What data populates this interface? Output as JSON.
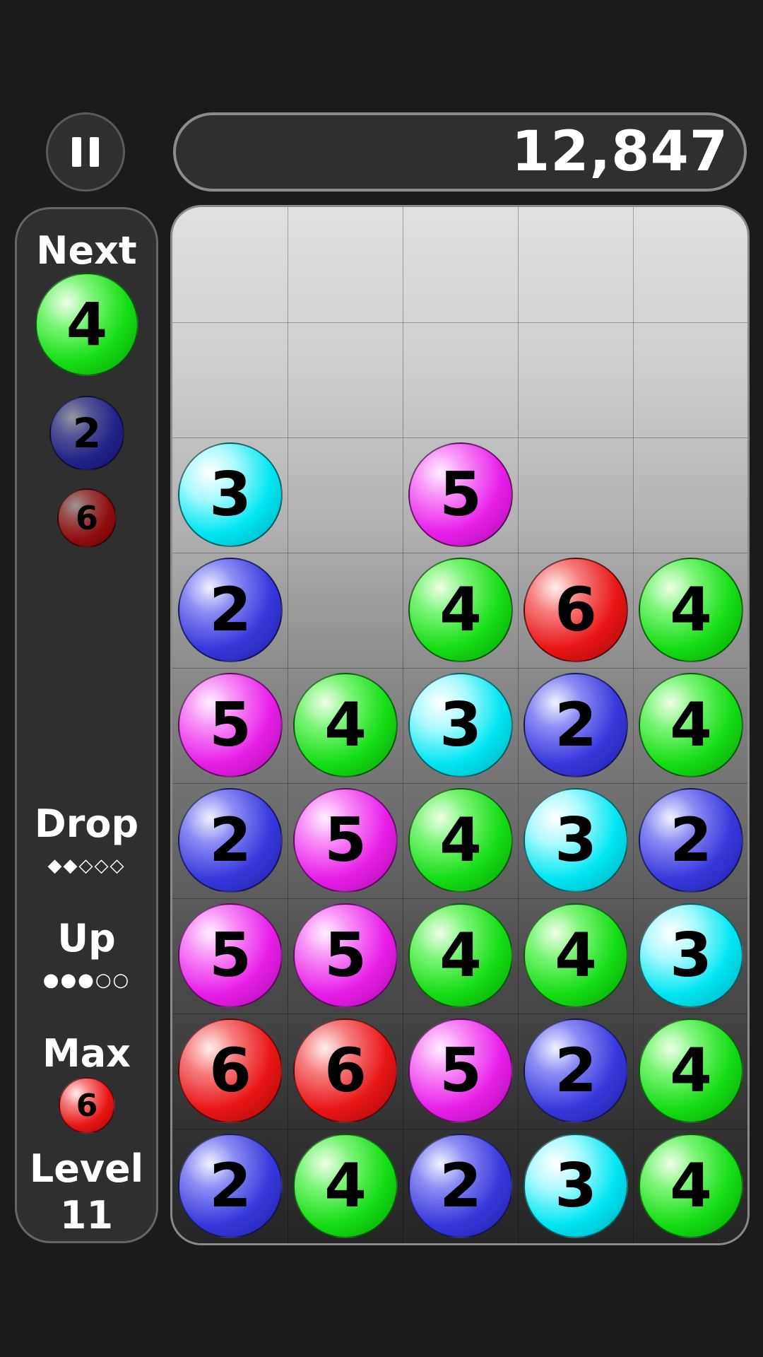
{
  "score": "12,847",
  "side": {
    "next_label": "Next",
    "next_queue": [
      4,
      2,
      6
    ],
    "drop_label": "Drop",
    "drop_pips": "◆◆◇◇◇",
    "up_label": "Up",
    "up_pips": "●●●○○",
    "max_label": "Max",
    "max_value": 6,
    "level_label": "Level",
    "level_value": "11"
  },
  "board": {
    "columns": 5,
    "rows": 9,
    "grid": [
      [
        0,
        0,
        0,
        0,
        0
      ],
      [
        0,
        0,
        0,
        0,
        0
      ],
      [
        3,
        0,
        5,
        0,
        0
      ],
      [
        2,
        0,
        4,
        6,
        4
      ],
      [
        5,
        4,
        3,
        2,
        4
      ],
      [
        2,
        5,
        4,
        3,
        2
      ],
      [
        5,
        5,
        4,
        4,
        3
      ],
      [
        6,
        6,
        5,
        2,
        4
      ],
      [
        2,
        4,
        2,
        3,
        4
      ]
    ]
  },
  "colors": {
    "2": "#3838dd",
    "3": "#00e6f2",
    "4": "#14dd14",
    "5": "#e81ee8",
    "6": "#e81616"
  }
}
